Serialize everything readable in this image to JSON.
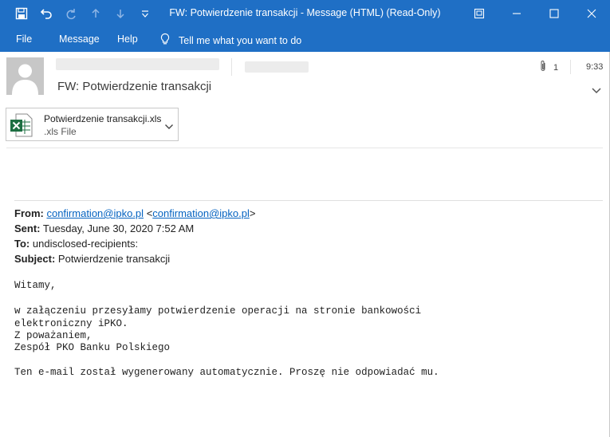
{
  "window": {
    "title": "FW: Potwierdzenie transakcji  -  Message (HTML) (Read-Only)"
  },
  "menu": {
    "file": "File",
    "message": "Message",
    "help": "Help",
    "tell_me": "Tell me what you want to do"
  },
  "header": {
    "subject": "FW: Potwierdzenie transakcji",
    "attachment_count": "1",
    "time": "9:33"
  },
  "attachment": {
    "name": "Potwierdzenie transakcji.xls",
    "type": ".xls File"
  },
  "forwarded": {
    "from_label": "From:",
    "from_link": "confirmation@ipko.pl",
    "from_link2": "confirmation@ipko.pl",
    "sent_label": "Sent:",
    "sent_value": "Tuesday, June 30, 2020 7:52 AM",
    "to_label": "To:",
    "to_value": "undisclosed-recipients:",
    "subject_label": "Subject:",
    "subject_value": "Potwierdzenie transakcji"
  },
  "body": {
    "greeting": "Witamy,",
    "line1": "w załączeniu przesyłamy potwierdzenie operacji na stronie bankowości",
    "line2": "elektroniczny iPKO.",
    "line3": "Z poważaniem,",
    "line4": "Zespół PKO Banku Polskiego",
    "footer": "Ten e-mail został wygenerowany automatycznie. Proszę nie odpowiadać mu."
  },
  "colors": {
    "accent": "#1f6fc5",
    "link": "#0563c1",
    "excel_green": "#1d6f42"
  },
  "icons": [
    "save-icon",
    "undo-icon",
    "redo-icon",
    "up-arrow-icon",
    "down-arrow-icon",
    "customize-icon",
    "restore-icon",
    "minimize-icon",
    "maximize-icon",
    "close-icon",
    "lightbulb-icon",
    "paperclip-icon",
    "chevron-down-icon",
    "excel-file-icon",
    "avatar-icon"
  ]
}
